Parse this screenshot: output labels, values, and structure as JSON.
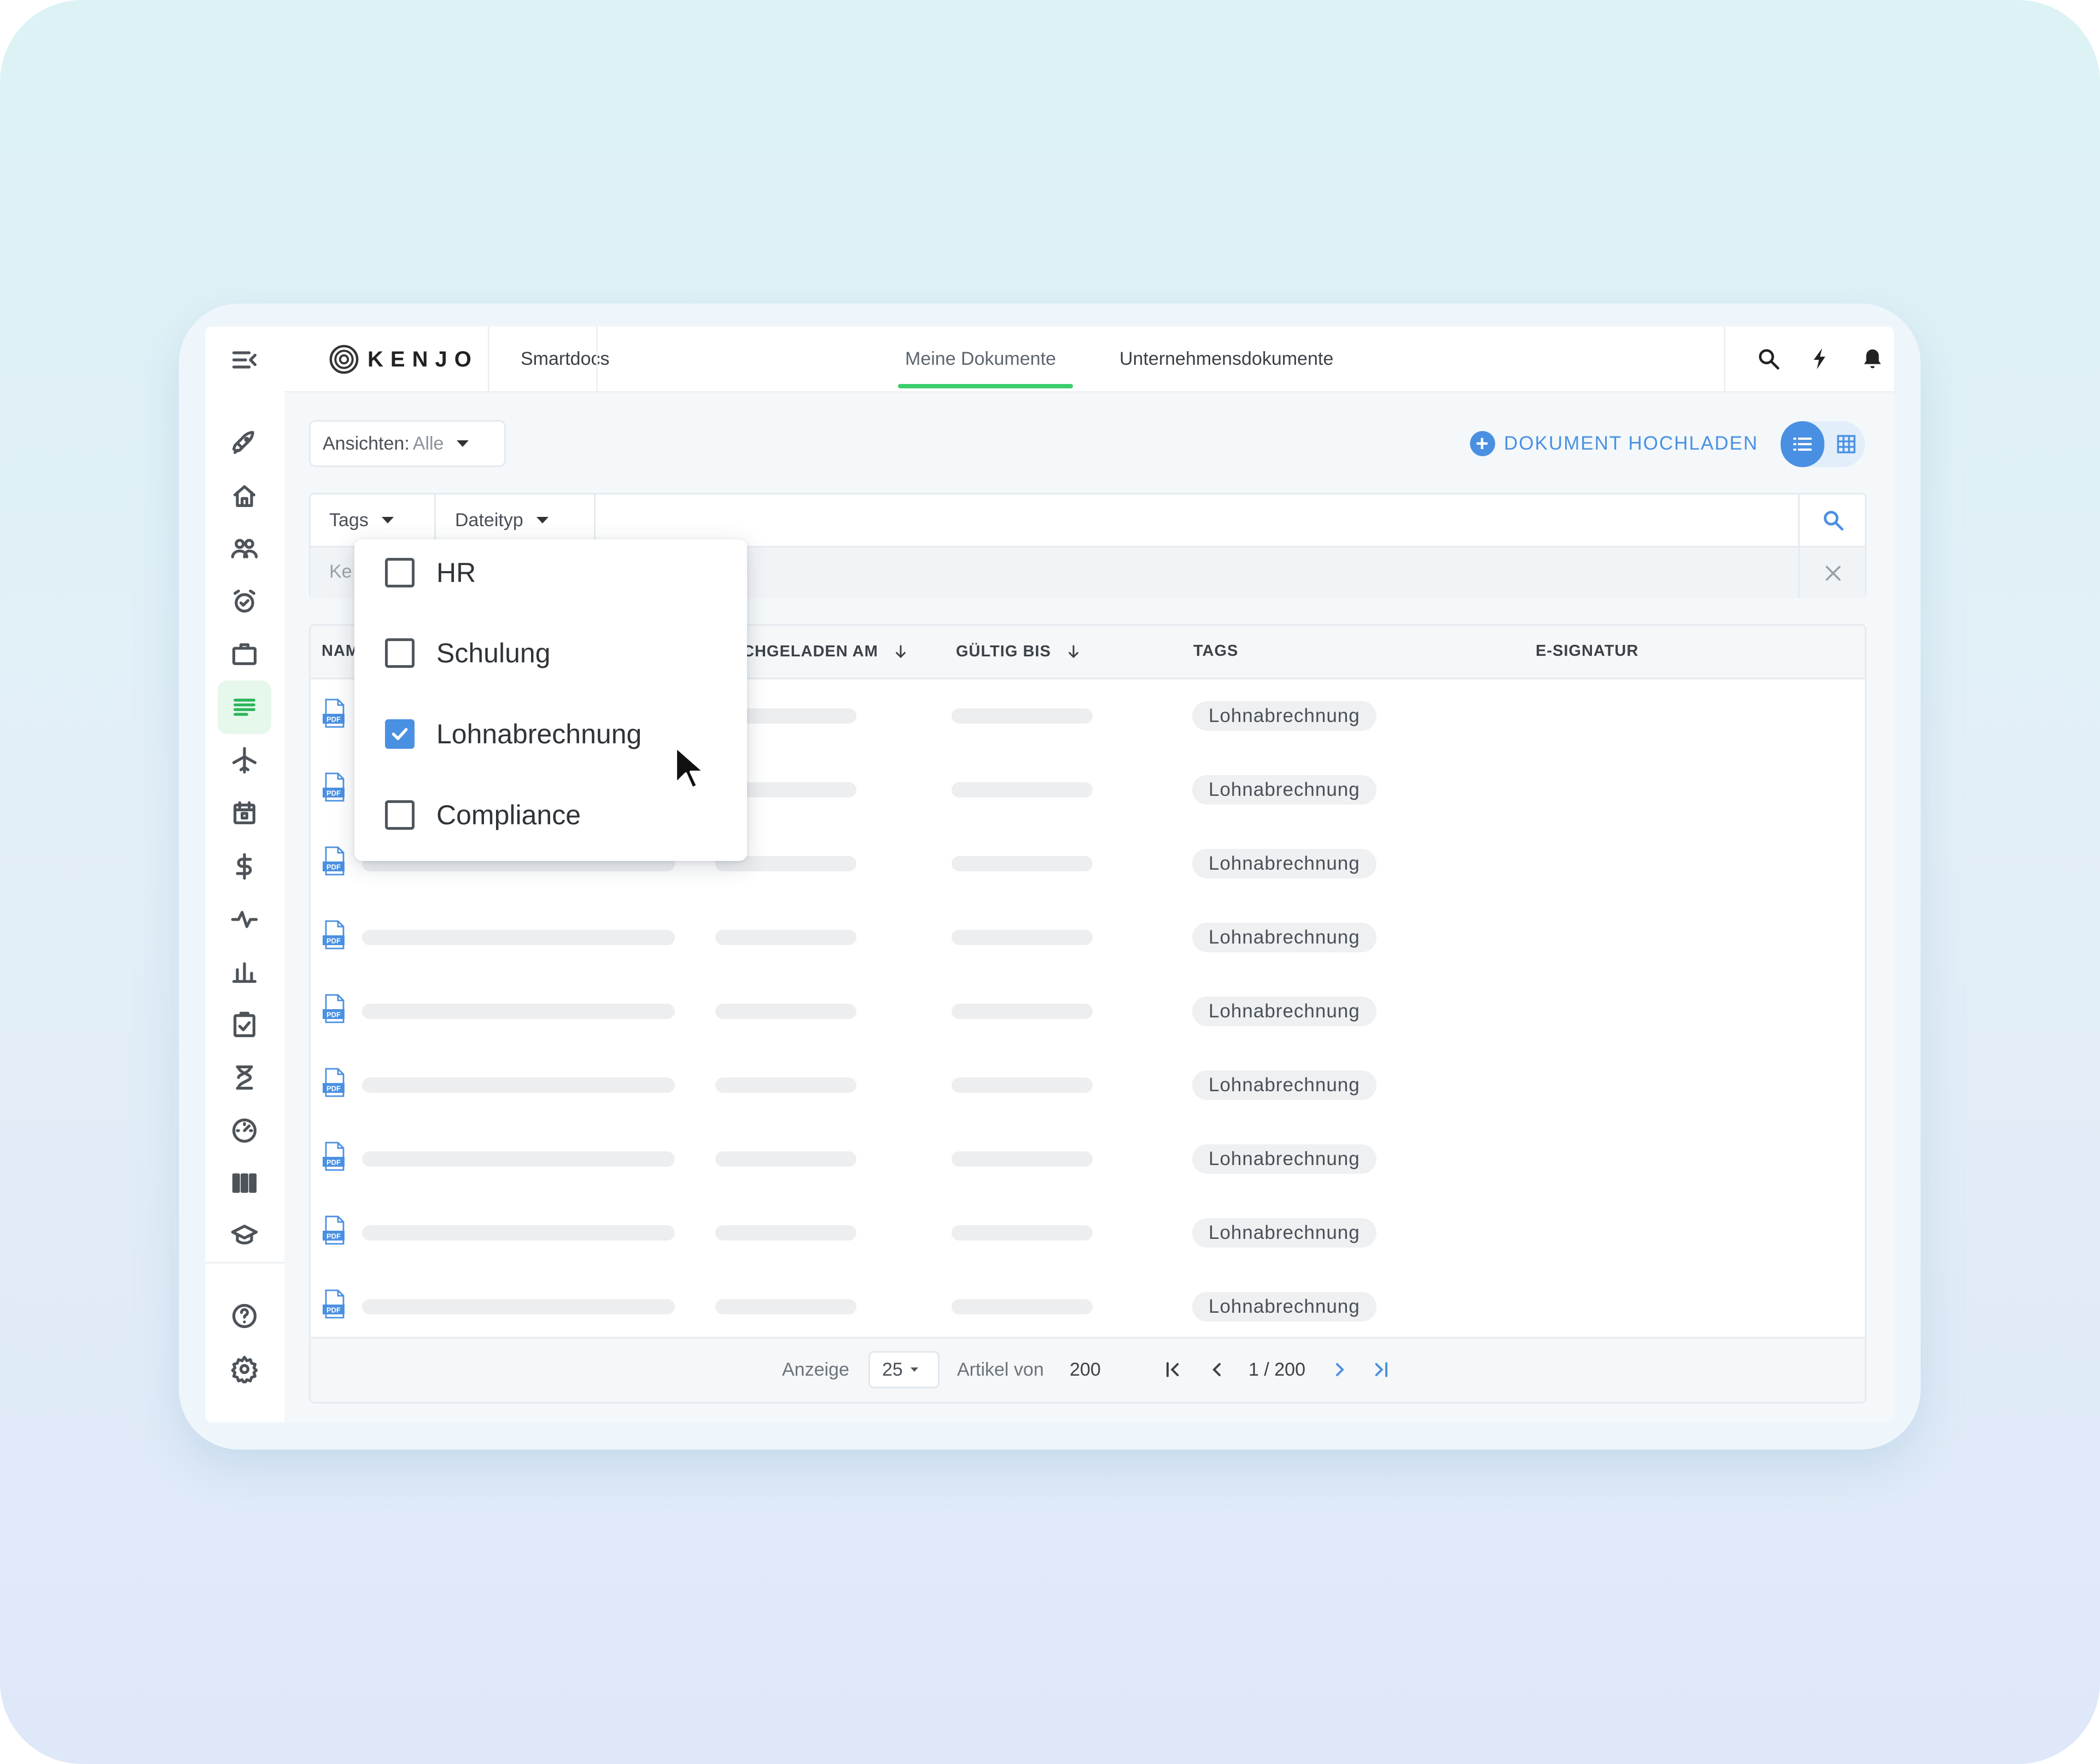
{
  "app": {
    "logo_text": "KENJO",
    "tabs": [
      {
        "label": "Smartdocs",
        "active": false
      },
      {
        "label": "Meine Dokumente",
        "active": true
      },
      {
        "label": "Unternehmensdokumente",
        "active": false
      }
    ],
    "top_icons": [
      "search-icon",
      "lightning-icon",
      "bell-icon"
    ],
    "accent_color": "#4a90e2",
    "active_tab_color": "#3ccd6c"
  },
  "sidebar": {
    "items": [
      {
        "icon": "menu-collapse-icon",
        "active": false
      },
      {
        "icon": "rocket-icon",
        "active": false
      },
      {
        "icon": "home-icon",
        "active": false
      },
      {
        "icon": "people-icon",
        "active": false
      },
      {
        "icon": "alarm-clock-icon",
        "active": false
      },
      {
        "icon": "briefcase-icon",
        "active": false
      },
      {
        "icon": "documents-icon",
        "active": true
      },
      {
        "icon": "airplane-icon",
        "active": false
      },
      {
        "icon": "calendar-icon",
        "active": false
      },
      {
        "icon": "dollar-icon",
        "active": false
      },
      {
        "icon": "pulse-icon",
        "active": false
      },
      {
        "icon": "bar-chart-icon",
        "active": false
      },
      {
        "icon": "checklist-icon",
        "active": false
      },
      {
        "icon": "hourglass-icon",
        "active": false
      },
      {
        "icon": "speedometer-icon",
        "active": false
      },
      {
        "icon": "columns-icon",
        "active": false
      },
      {
        "icon": "graduation-cap-icon",
        "active": false
      },
      {
        "icon": "help-icon",
        "active": false
      },
      {
        "icon": "settings-icon",
        "active": false
      }
    ]
  },
  "toolbar": {
    "views_label": "Ansichten:",
    "views_value": "Alle",
    "upload_label": "DOKUMENT HOCHLADEN"
  },
  "filters": {
    "tags_label": "Tags",
    "filetype_label": "Dateityp",
    "keyword_partial": "Ke"
  },
  "tags_dropdown": {
    "options": [
      {
        "label": "HR",
        "checked": false
      },
      {
        "label": "Schulung",
        "checked": false
      },
      {
        "label": "Lohnabrechnung",
        "checked": true
      },
      {
        "label": "Compliance",
        "checked": false
      }
    ]
  },
  "table": {
    "columns": [
      "NAME",
      "HOCHGELADEN AM",
      "GÜLTIG BIS",
      "TAGS",
      "E-SIGNATUR"
    ],
    "visible_column_text": {
      "name": "NAM",
      "uploaded": "CHGELADEN AM"
    },
    "rows": [
      {
        "file_type": "PDF",
        "tag": "Lohnabrechnung"
      },
      {
        "file_type": "PDF",
        "tag": "Lohnabrechnung"
      },
      {
        "file_type": "PDF",
        "tag": "Lohnabrechnung"
      },
      {
        "file_type": "PDF",
        "tag": "Lohnabrechnung"
      },
      {
        "file_type": "PDF",
        "tag": "Lohnabrechnung"
      },
      {
        "file_type": "PDF",
        "tag": "Lohnabrechnung"
      },
      {
        "file_type": "PDF",
        "tag": "Lohnabrechnung"
      },
      {
        "file_type": "PDF",
        "tag": "Lohnabrechnung"
      },
      {
        "file_type": "PDF",
        "tag": "Lohnabrechnung"
      }
    ]
  },
  "pagination": {
    "show_label": "Anzeige",
    "page_size": "25",
    "items_label": "Artikel von",
    "total": "200",
    "page_indicator": "1 / 200"
  }
}
